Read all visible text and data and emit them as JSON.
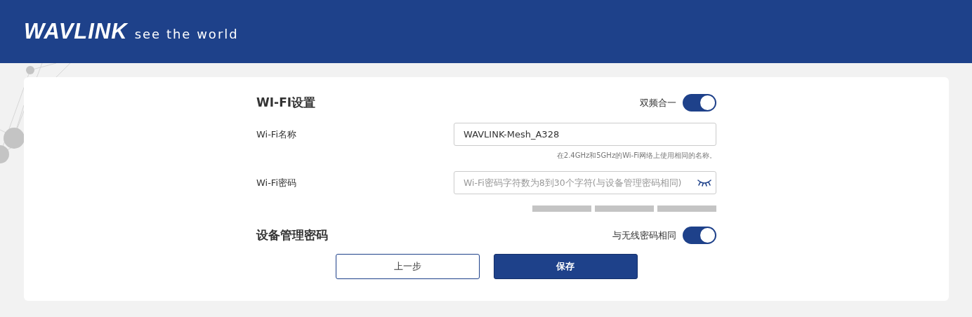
{
  "header": {
    "logo": "WAVLINK",
    "slogan": "see the world"
  },
  "wifi_settings": {
    "title": "WI-FI设置",
    "toggle_label": "双频合一",
    "toggle_on": true,
    "name_field": {
      "label": "Wi-Fi名称",
      "value": "WAVLINK-Mesh_A328",
      "hint": "在2.4GHz和5GHz的Wi-Fi网络上使用相同的名称。"
    },
    "password_field": {
      "label": "Wi-Fi密码",
      "placeholder": "Wi-Fi密码字符数为8到30个字符(与设备管理密码相同)"
    }
  },
  "admin_password": {
    "title": "设备管理密码",
    "toggle_label": "与无线密码相同",
    "toggle_on": true
  },
  "buttons": [
    {
      "label": "上一步",
      "kind": "secondary"
    },
    {
      "label": "保存",
      "kind": "primary"
    }
  ]
}
